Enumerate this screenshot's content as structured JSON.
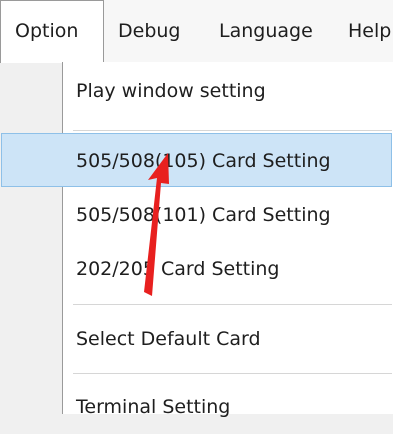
{
  "menubar": {
    "items": [
      {
        "label": "Option"
      },
      {
        "label": "Debug"
      },
      {
        "label": "Language"
      },
      {
        "label": "Help"
      }
    ]
  },
  "dropdown": {
    "items": [
      {
        "label": "Play window setting"
      },
      {
        "label": "505/508(105) Card Setting",
        "highlighted": true
      },
      {
        "label": "505/508(101) Card Setting"
      },
      {
        "label": "202/205 Card Setting"
      },
      {
        "label": "Select Default Card"
      },
      {
        "label": "Terminal Setting"
      }
    ]
  },
  "annotation": {
    "color": "#e8201f"
  }
}
